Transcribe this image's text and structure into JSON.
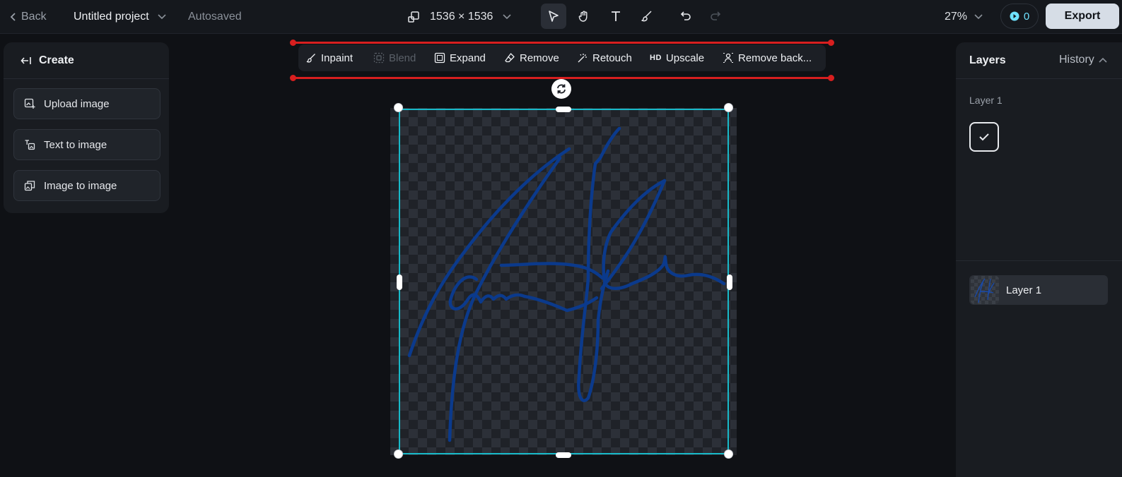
{
  "topbar": {
    "back_label": "Back",
    "project_name": "Untitled project",
    "autosaved_label": "Autosaved",
    "canvas_size": "1536 × 1536",
    "zoom": "27%",
    "credits": "0",
    "export_label": "Export"
  },
  "tools": [
    "select-icon",
    "hand-icon",
    "text-icon",
    "brush-icon",
    "undo-icon",
    "redo-icon"
  ],
  "create_panel": {
    "title": "Create",
    "buttons": [
      "Upload image",
      "Text to image",
      "Image to image"
    ]
  },
  "edit_toolbar": {
    "items": [
      "Inpaint",
      "Blend",
      "Expand",
      "Remove",
      "Retouch",
      "Upscale",
      "Remove back..."
    ],
    "hd_tag": "HD"
  },
  "layers_panel": {
    "title": "Layers",
    "history_label": "History",
    "layer_label": "Layer 1",
    "layer_row_name": "Layer 1"
  },
  "colors": {
    "selection": "#18b9c8",
    "guide": "#d81f1f",
    "signature": "#0b3a8c",
    "credit": "#6fe2ff"
  }
}
